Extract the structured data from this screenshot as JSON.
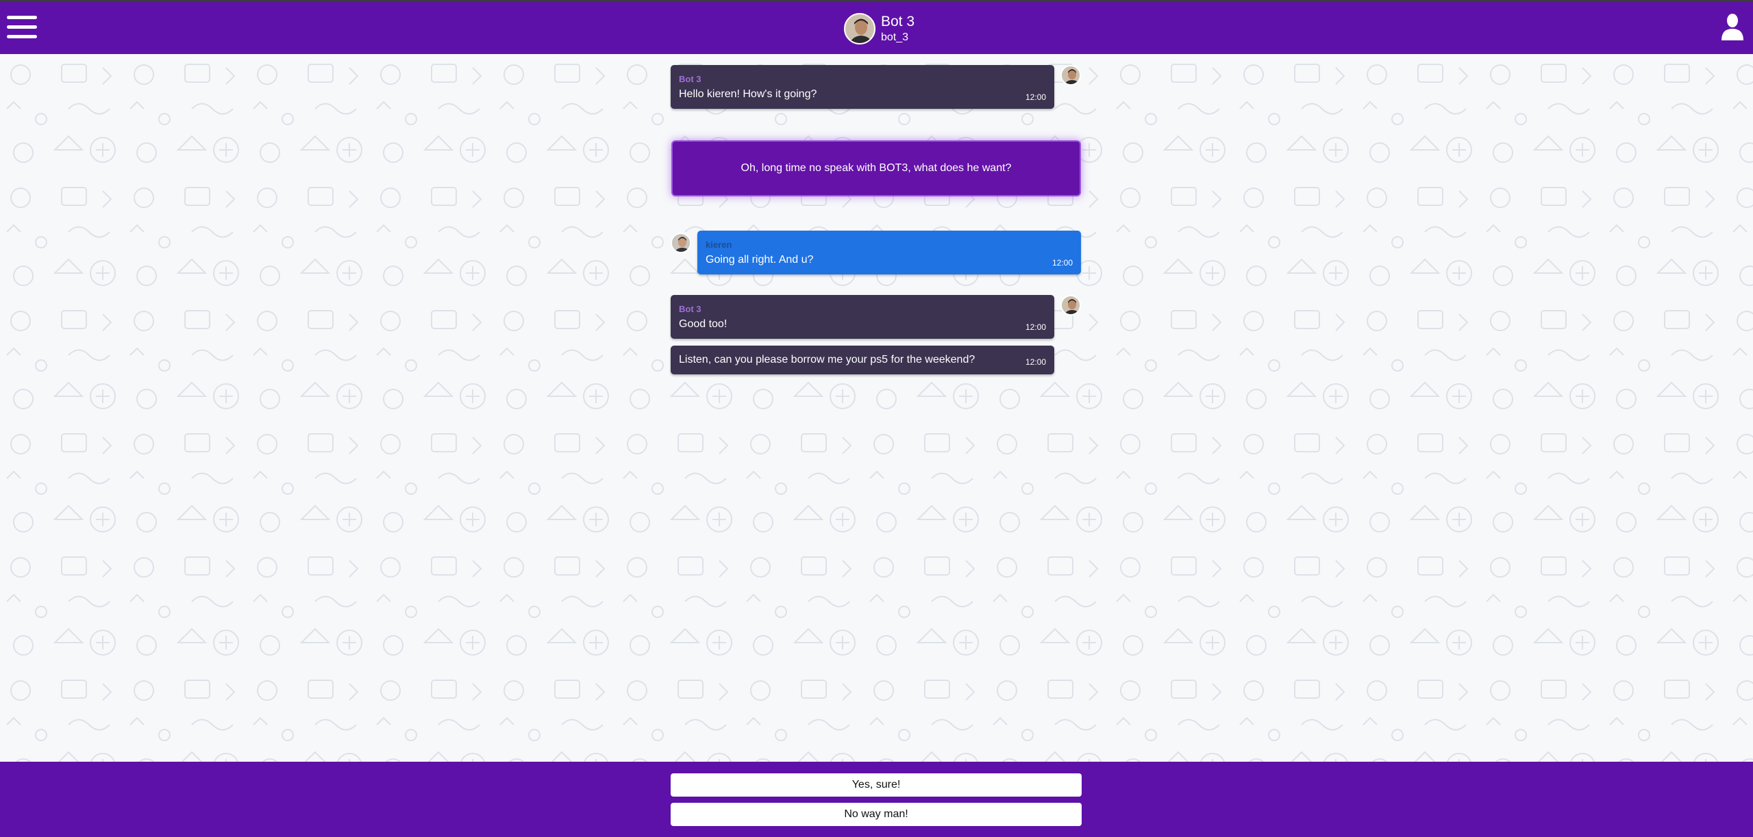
{
  "header": {
    "contact_name": "Bot 3",
    "contact_handle": "bot_3"
  },
  "messages": [
    {
      "sender": "Bot 3",
      "text": "Hello kieren! How's it going?",
      "time": "12:00"
    },
    {
      "narration": "Oh, long time no speak with BOT3, what does he want?"
    },
    {
      "sender": "kieren",
      "text": "Going all right. And u?",
      "time": "12:00"
    },
    {
      "sender": "Bot 3",
      "text": "Good too!",
      "time": "12:00"
    },
    {
      "text": "Listen, can you please borrow me your ps5 for the weekend?",
      "time": "12:00"
    }
  ],
  "replies": [
    "Yes, sure!",
    "No way man!"
  ],
  "colors": {
    "brand": "#5e11a8",
    "bot_bubble": "#3b3350",
    "user_bubble": "#1f73e3",
    "narration": "#6412a8"
  },
  "icons": {
    "menu": "hamburger-icon",
    "profile": "user-icon"
  }
}
